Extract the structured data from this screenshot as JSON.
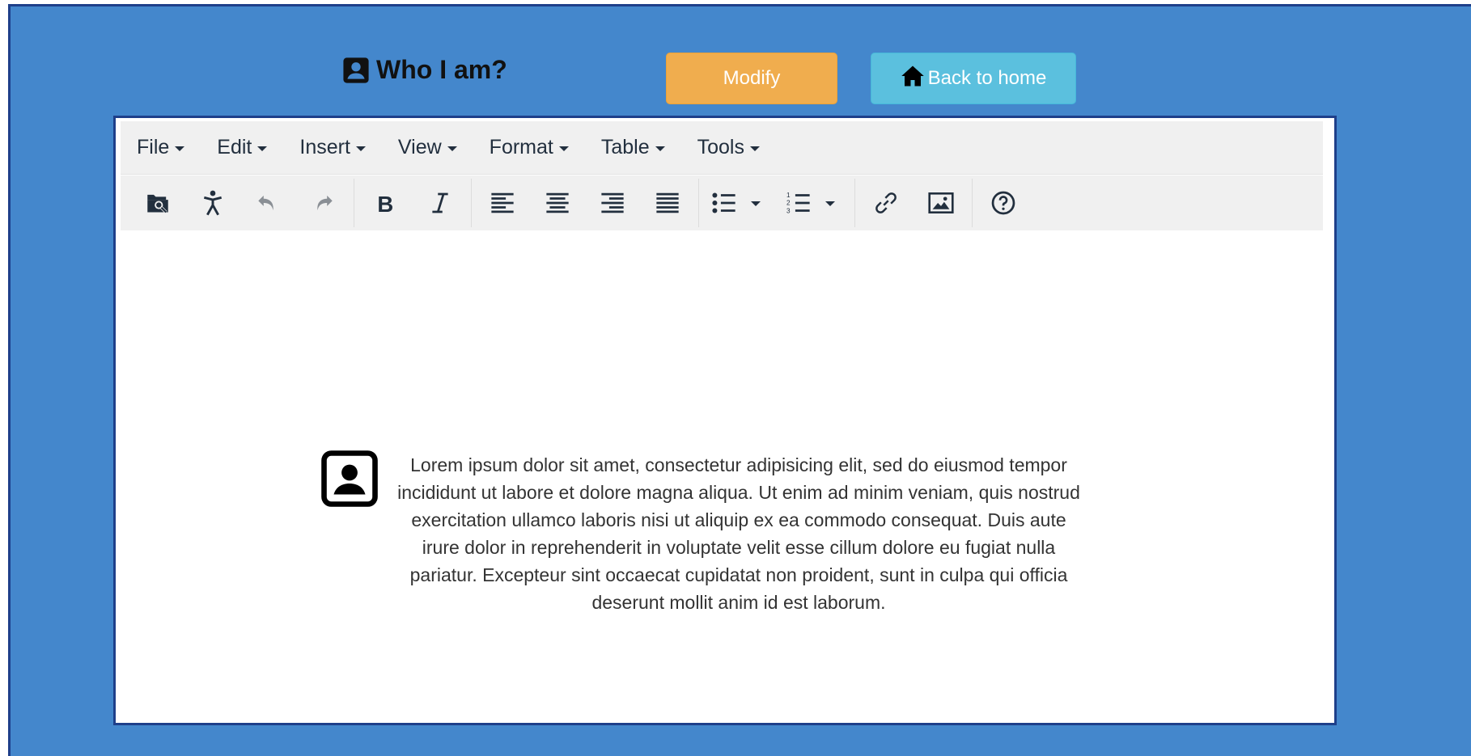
{
  "header": {
    "title": "Who I am?",
    "modify_label": "Modify",
    "home_label": "Back to home"
  },
  "editor": {
    "menus": [
      "File",
      "Edit",
      "Insert",
      "View",
      "Format",
      "Table",
      "Tools"
    ],
    "toolbar_icons": [
      "preview-icon",
      "accessibility-icon",
      "undo-icon",
      "redo-icon",
      "bold-icon",
      "italic-icon",
      "align-left-icon",
      "align-center-icon",
      "align-right-icon",
      "align-justify-icon",
      "bullet-list-icon",
      "numbered-list-icon",
      "link-icon",
      "image-icon",
      "help-icon"
    ],
    "body_text": "Lorem ipsum dolor sit amet, consectetur adipisicing elit, sed do eiusmod tempor incididunt ut labore et dolore magna aliqua. Ut enim ad minim veniam, quis nostrud exercitation ullamco laboris nisi ut aliquip ex ea commodo consequat. Duis aute irure dolor in reprehenderit in voluptate velit esse cillum dolore eu fugiat nulla pariatur. Excepteur sint occaecat cupidatat non proident, sunt in culpa qui officia deserunt mollit anim id est laborum."
  },
  "colors": {
    "background": "#4487cc",
    "border": "#1e3f8a",
    "modify_button": "#f0ad4e",
    "home_button": "#5bc0de"
  }
}
